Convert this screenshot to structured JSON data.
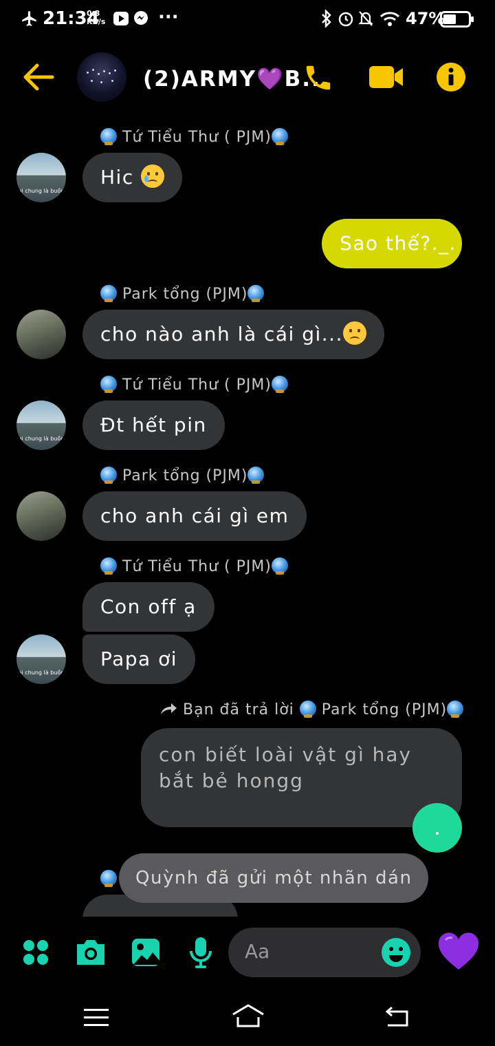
{
  "status_bar": {
    "time": "21:34",
    "net_speed_value": "0.3",
    "net_speed_unit": "KB/s",
    "more": "···",
    "battery": "47%",
    "icons": [
      "airplane-icon",
      "youtube-icon",
      "messenger-icon",
      "bluetooth-icon",
      "alarm-icon",
      "mute-icon",
      "wifi-icon",
      "battery-icon"
    ]
  },
  "header": {
    "title": "(2)ARMY💜B...",
    "actions": [
      "back-arrow-icon",
      "phone-icon",
      "video-icon",
      "info-icon"
    ],
    "accent": "#f7c600"
  },
  "messages": [
    {
      "sender": "Tứ Tiểu Thư ( PJM)",
      "text": "Hic",
      "emoji": "crying-face"
    },
    {
      "text": "Sao thế?._.",
      "outgoing": true
    },
    {
      "sender": "Park tổng (PJM)",
      "text": "cho nào anh là cái gì...",
      "emoji": "worried-face"
    },
    {
      "sender": "Tứ Tiểu Thư ( PJM)",
      "text": "Đt hết pin"
    },
    {
      "sender": "Park tổng (PJM)",
      "text": "cho anh cái gì em"
    },
    {
      "sender": "Tứ Tiểu Thư ( PJM)",
      "texts": [
        "Con off ạ",
        "Papa ơi"
      ]
    },
    {
      "reply_to": "Bạn đã trả lời",
      "reply_target": "Park tổng (PJM)",
      "text": "con biết loài vật gì hay bắt bẻ hongg",
      "outgoing": true
    }
  ],
  "toast": "Quỳnh đã gửi một nhãn dán",
  "composer": {
    "placeholder": "Aa",
    "icons": [
      "menu-dots-icon",
      "camera-icon",
      "gallery-icon",
      "microphone-icon",
      "emoji-icon",
      "heart-icon"
    ],
    "accent": "#19d3b0"
  },
  "nav": [
    "menu-icon",
    "home-icon",
    "back-icon"
  ]
}
